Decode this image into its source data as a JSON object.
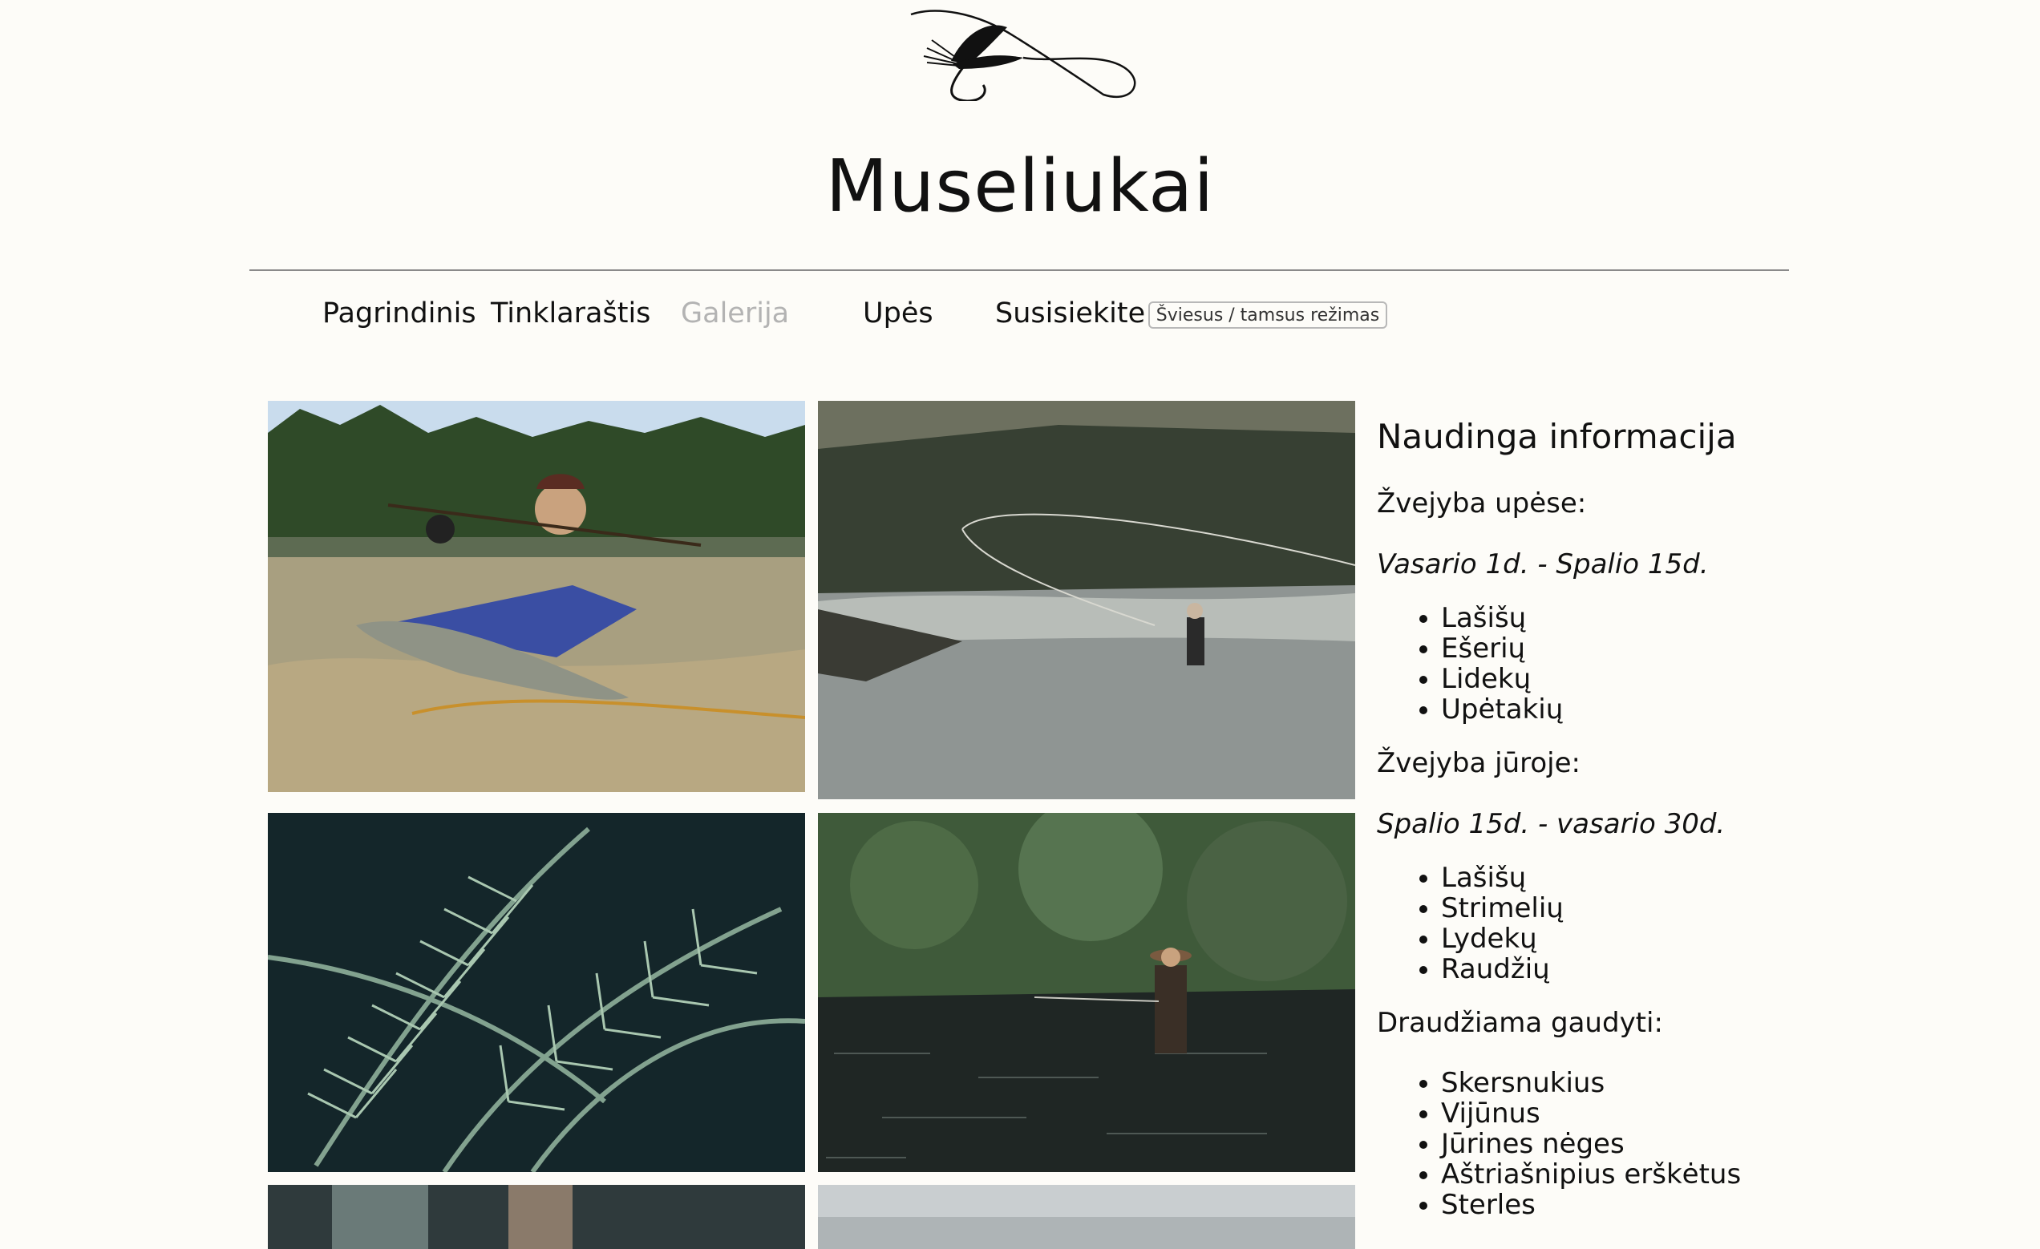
{
  "site": {
    "title": "Museliukai"
  },
  "nav": {
    "items": [
      {
        "label": "Pagrindinis"
      },
      {
        "label": "Tinklaraštis"
      },
      {
        "label": "Galerija",
        "active": true
      },
      {
        "label": "Upės"
      },
      {
        "label": "Susisiekite"
      }
    ],
    "mode_toggle": "Šviesus / tamsus režimas"
  },
  "gallery": {
    "photos": [
      {
        "icon": "angler-holding-fish-photo"
      },
      {
        "icon": "angler-casting-river-photo"
      },
      {
        "icon": "fern-leaves-photo"
      },
      {
        "icon": "angler-wading-river-photo"
      },
      {
        "icon": "gallery-photo"
      },
      {
        "icon": "gallery-photo"
      }
    ]
  },
  "info": {
    "heading": "Naudinga informacija",
    "river": {
      "label": "Žvejyba upėse:",
      "dates": "Vasario 1d. - Spalio 15d.",
      "fish": [
        "Lašišų",
        "Ešerių",
        "Lidekų",
        "Upėtakių"
      ]
    },
    "sea": {
      "label": "Žvejyba jūroje:",
      "dates": "Spalio 15d. - vasario 30d.",
      "fish": [
        "Lašišų",
        "Strimelių",
        "Lydekų",
        "Raudžių"
      ]
    },
    "forbidden": {
      "label": "Draudžiama gaudyti:",
      "fish": [
        "Skersnukius",
        "Vijūnus",
        "Jūrines nėges",
        "Aštriašnipius erškėtus",
        "Sterles"
      ]
    }
  },
  "colors": {
    "background": "#fdfcf8",
    "text": "#111111",
    "active_nav": "#b3b3b3",
    "rule": "#8a8a8a"
  }
}
